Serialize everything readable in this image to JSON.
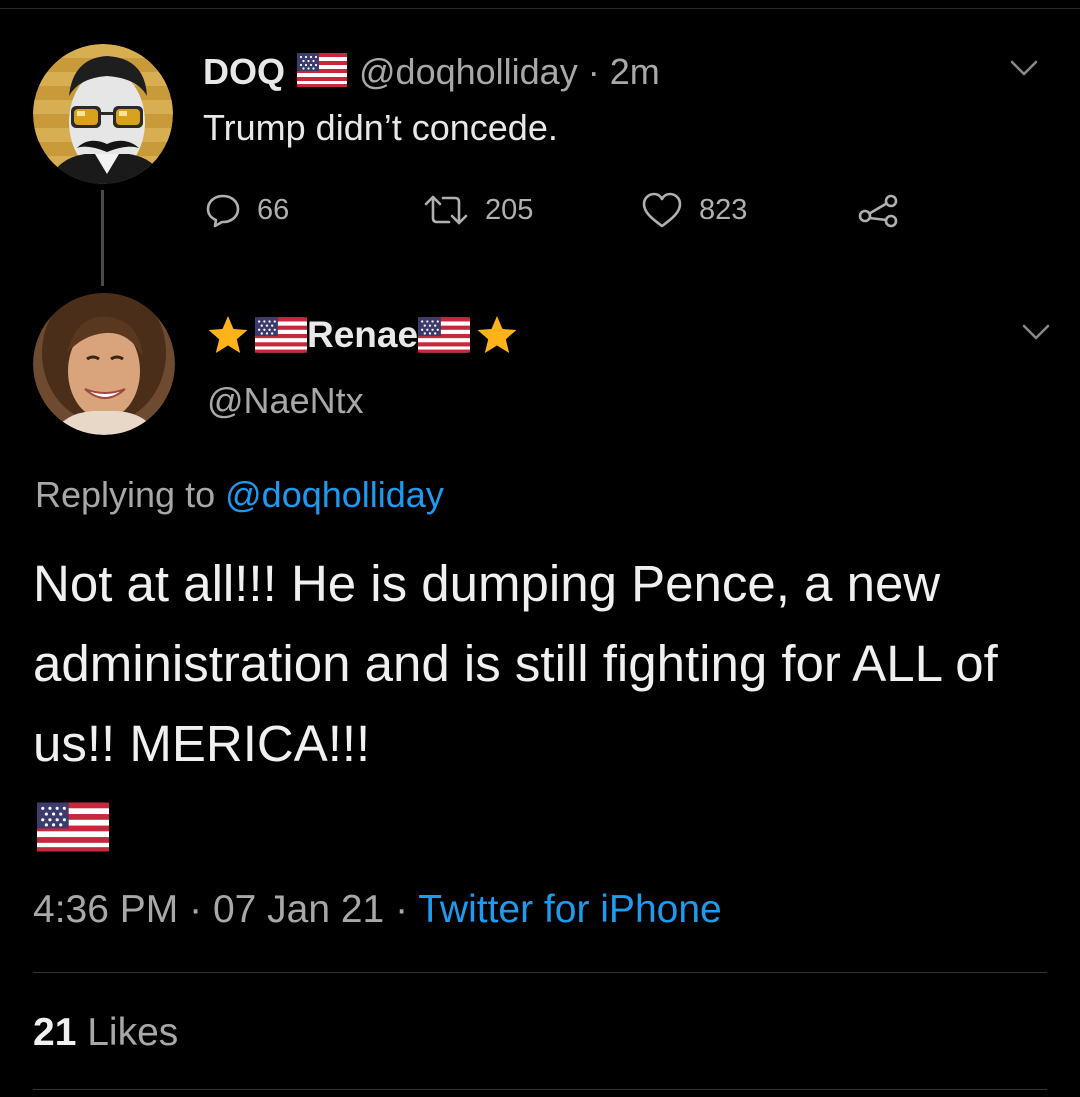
{
  "parent_tweet": {
    "display_name": "DOQ",
    "name_flag": "us-flag-icon",
    "handle": "@doqholliday",
    "separator": "·",
    "time_ago": "2m",
    "text": "Trump didn’t concede.",
    "actions": {
      "reply_count": "66",
      "retweet_count": "205",
      "like_count": "823"
    }
  },
  "reply_tweet": {
    "display_name": "Renae",
    "name_decorations": [
      "star-icon",
      "us-flag-icon",
      "us-flag-icon",
      "star-icon"
    ],
    "handle": "@NaeNtx",
    "replying_prefix": "Replying to",
    "replying_to": "@doqholliday",
    "text": "Not at all!!! He is dumping Pence, a new administration and is still fighting for ALL of us!! MERICA!!!",
    "text_emoji": "us-flag-icon",
    "time": "4:36 PM",
    "date": "07 Jan 21",
    "separator": "·",
    "source": "Twitter for iPhone",
    "likes_count": "21",
    "likes_label": "Likes"
  },
  "colors": {
    "background": "#000000",
    "primary_text": "#e8e8e8",
    "secondary_text": "#a8a8a8",
    "link": "#1d9bf0",
    "star": "#ffb31a"
  }
}
